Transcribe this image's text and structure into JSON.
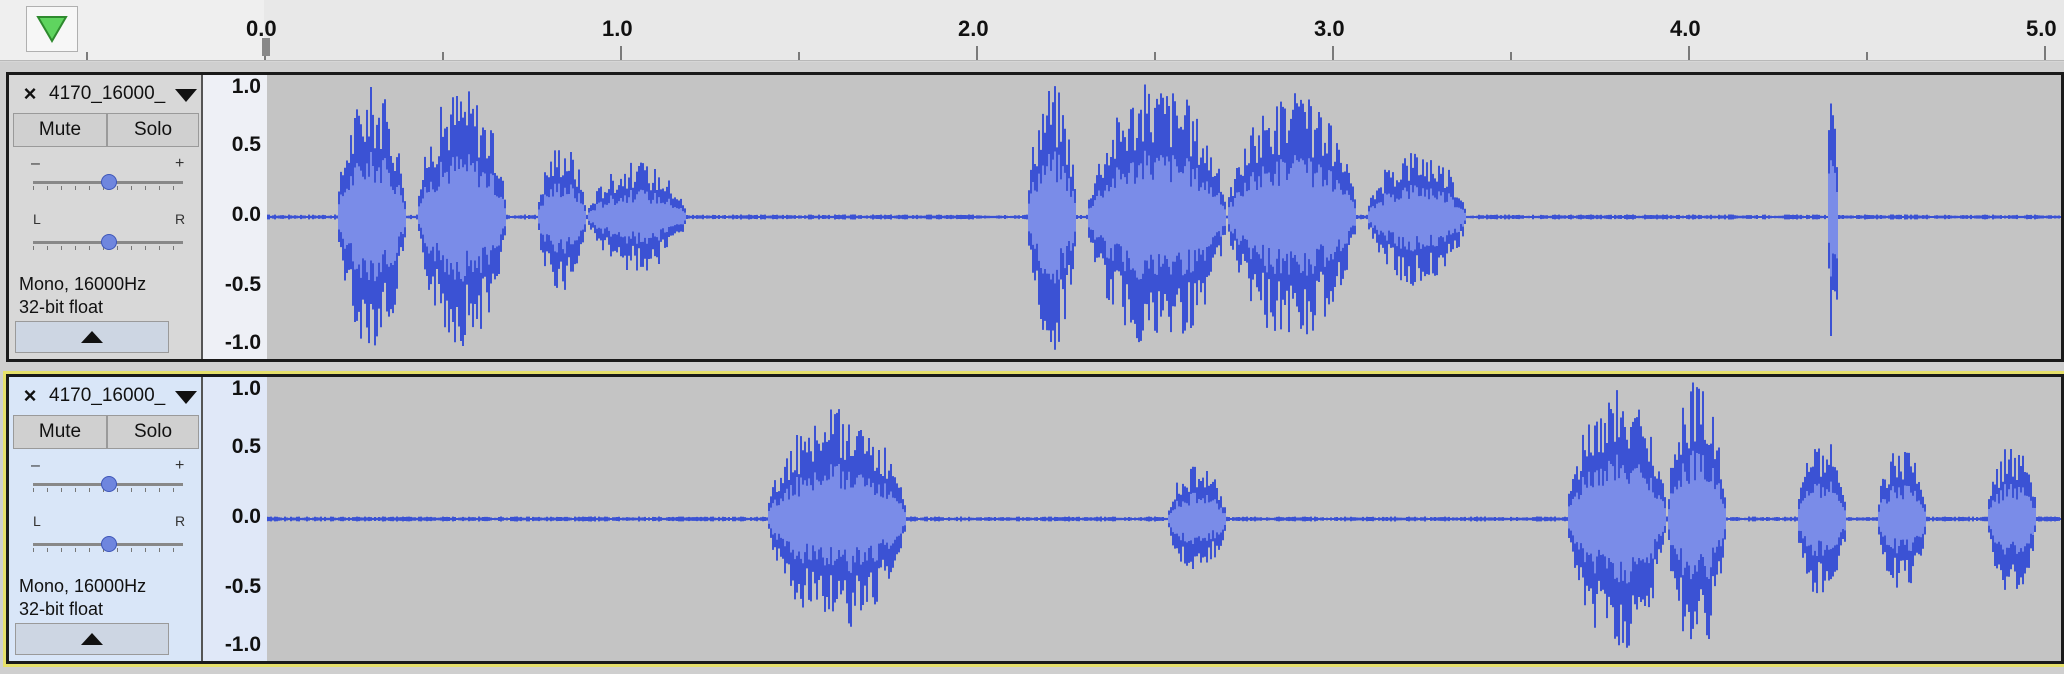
{
  "ruler": {
    "labels": [
      "0.0",
      "1.0",
      "2.0",
      "3.0",
      "4.0",
      "5.0"
    ]
  },
  "play_button_icon": "green-triangle-down-icon",
  "colors": {
    "waveform_outer": "#3b52d4",
    "waveform_inner": "#7a8ce8",
    "selected_track_border": "#e6e06a"
  },
  "tracks": [
    {
      "close": "×",
      "name": "4170_16000_",
      "mute_label": "Mute",
      "solo_label": "Solo",
      "gain_minus": "–",
      "gain_plus": "+",
      "pan_left": "L",
      "pan_right": "R",
      "format_line1": "Mono, 16000Hz",
      "format_line2": "32-bit float",
      "scale": [
        "1.0",
        "0.5",
        "0.0",
        "-0.5",
        "-1.0"
      ]
    },
    {
      "close": "×",
      "name": "4170_16000_",
      "mute_label": "Mute",
      "solo_label": "Solo",
      "gain_minus": "–",
      "gain_plus": "+",
      "pan_left": "L",
      "pan_right": "R",
      "format_line1": "Mono, 16000Hz",
      "format_line2": "32-bit float",
      "scale": [
        "1.0",
        "0.5",
        "0.0",
        "-0.5",
        "-1.0"
      ]
    }
  ]
}
